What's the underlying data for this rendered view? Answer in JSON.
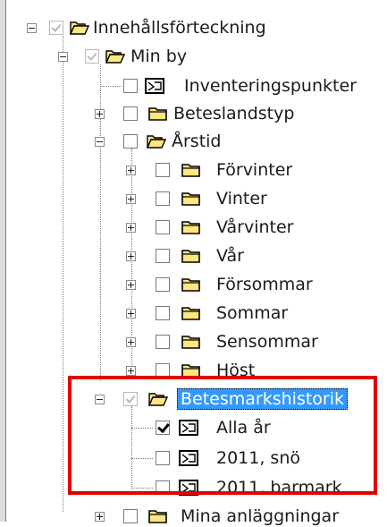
{
  "tree": {
    "root": {
      "label": "Innehållsförteckning"
    },
    "min_by": {
      "label": "Min by"
    },
    "inventeringspunkter": {
      "label": "Inventeringspunkter"
    },
    "beteslandstyp": {
      "label": "Beteslandstyp"
    },
    "arstid": {
      "label": "Årstid",
      "seasons": [
        "Förvinter",
        "Vinter",
        "Vårvinter",
        "Vår",
        "Försommar",
        "Sommar",
        "Sensommar",
        "Höst"
      ]
    },
    "betesmarkshistorik": {
      "label": "Betesmarkshistorik",
      "items": [
        "Alla år",
        "2011, snö",
        "2011, barmark"
      ]
    },
    "mina_anlaggningar": {
      "label": "Mina anläggningar"
    }
  },
  "colors": {
    "highlight": "#e00000",
    "selection": "#3399ff",
    "folder": "#ffe680"
  }
}
